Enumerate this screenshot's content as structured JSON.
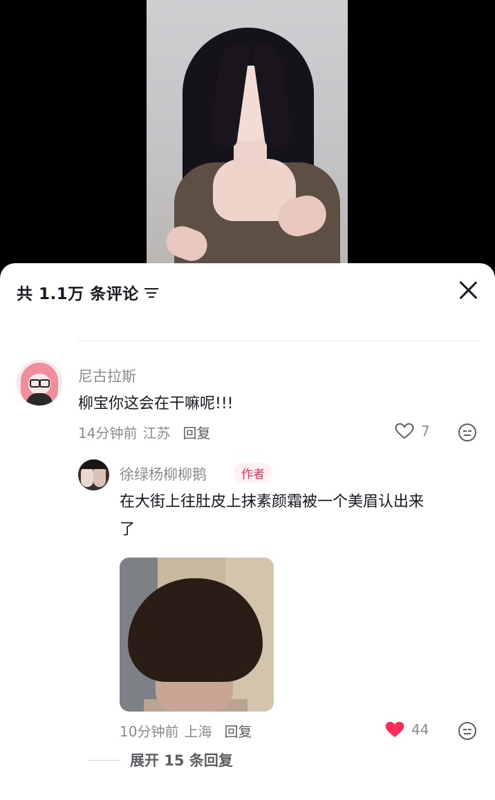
{
  "header": {
    "comment_count": "共 1.1万 条评论"
  },
  "comments": [
    {
      "username": "尼古拉斯",
      "text": "柳宝你这会在干嘛呢!!!",
      "time": "14分钟前",
      "location": "江苏",
      "reply_label": "回复",
      "likes": "7",
      "liked": false
    }
  ],
  "replies": [
    {
      "username": "徐绿杨柳柳鹅",
      "badge": "作者",
      "text_line1": "在大街上往肚皮上抹素颜霜被一个美眉认出来",
      "text_line2": "了",
      "time": "10分钟前",
      "location": "上海",
      "reply_label": "回复",
      "likes": "44",
      "liked": true
    }
  ],
  "expand": {
    "label": "展开 15 条回复"
  },
  "colors": {
    "accent": "#fe2c55",
    "text_primary": "#161823",
    "text_secondary": "#8a8b91"
  }
}
